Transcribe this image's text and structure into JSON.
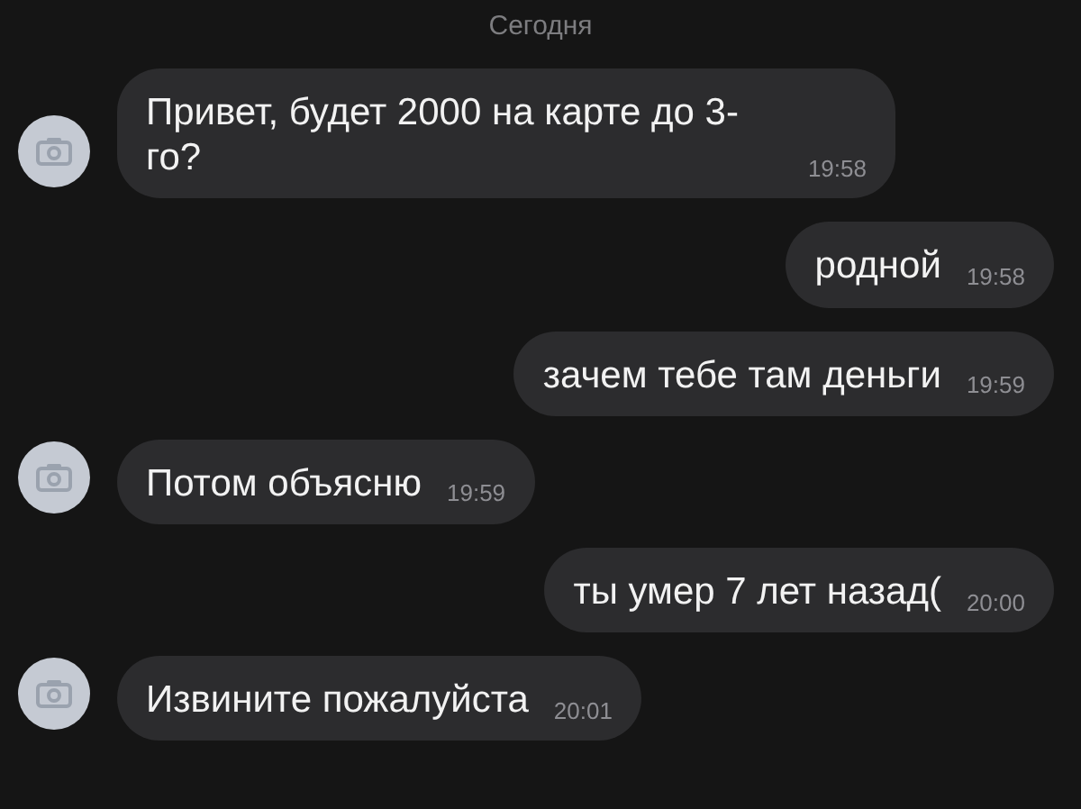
{
  "date_separator": "Сегодня",
  "messages": [
    {
      "kind": "incoming",
      "text": "Привет, будет 2000 на карте до 3-го?",
      "time": "19:58"
    },
    {
      "kind": "outgoing",
      "text": "родной",
      "time": "19:58"
    },
    {
      "kind": "outgoing",
      "text": "зачем тебе там деньги",
      "time": "19:59"
    },
    {
      "kind": "incoming",
      "text": "Потом объясню",
      "time": "19:59"
    },
    {
      "kind": "outgoing",
      "text": "ты умер 7 лет назад(",
      "time": "20:00"
    },
    {
      "kind": "incoming",
      "text": "Извините пожалуйста",
      "time": "20:01"
    }
  ]
}
